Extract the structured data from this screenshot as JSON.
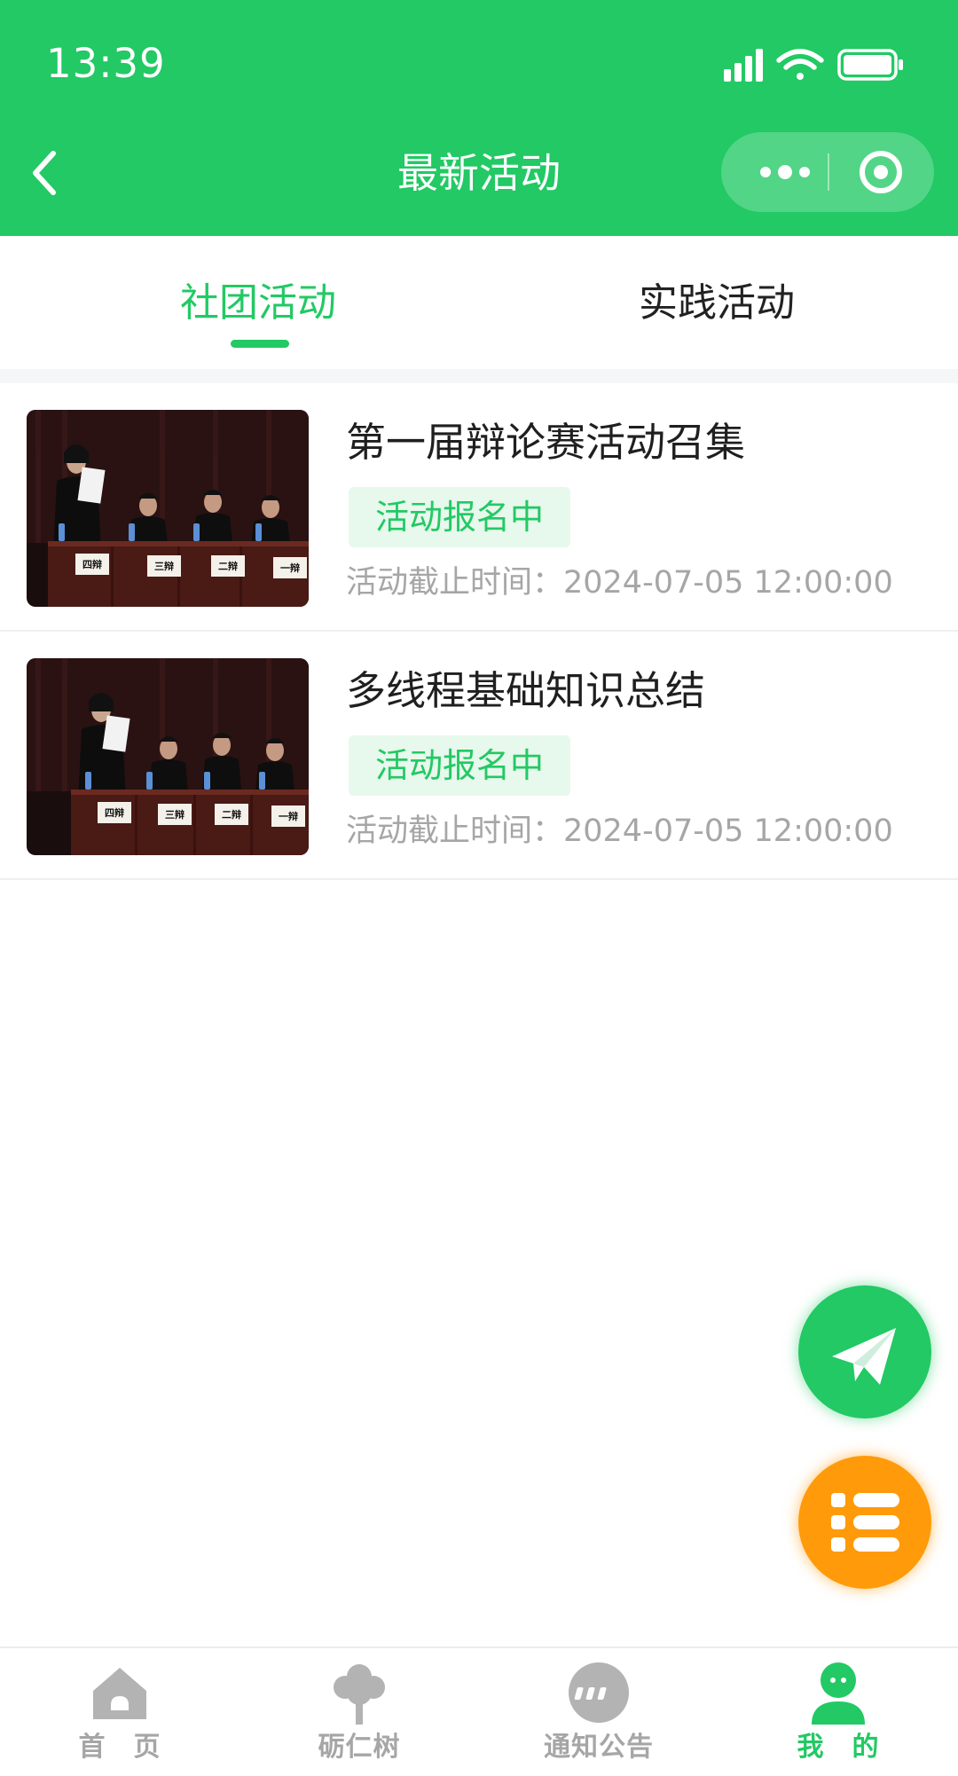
{
  "status_bar": {
    "time": "13:39"
  },
  "nav": {
    "title": "最新活动"
  },
  "tabs": [
    {
      "label": "社团活动",
      "active": true
    },
    {
      "label": "实践活动",
      "active": false
    }
  ],
  "activities": [
    {
      "title": "第一届辩论赛活动召集",
      "status": "活动报名中",
      "deadline": "活动截止时间：2024-07-05 12:00:00",
      "thumbnail": {
        "placards": [
          "四辩",
          "三辩",
          "二辩",
          "一辩"
        ]
      }
    },
    {
      "title": "多线程基础知识总结",
      "status": "活动报名中",
      "deadline": "活动截止时间：2024-07-05 12:00:00",
      "thumbnail": {
        "placards": [
          "四辩",
          "三辩",
          "二辩",
          "一辩"
        ]
      }
    }
  ],
  "fabs": {
    "send_icon": "paper-plane-icon",
    "list_icon": "list-icon"
  },
  "tabbar": [
    {
      "label": "首　页",
      "icon": "home-icon",
      "active": false
    },
    {
      "label": "砺仁树",
      "icon": "tree-icon",
      "active": false
    },
    {
      "label": "通知公告",
      "icon": "message-icon",
      "active": false
    },
    {
      "label": "我　的",
      "icon": "user-icon",
      "active": true
    }
  ],
  "colors": {
    "primary": "#22c964",
    "accent": "#ff9a0a",
    "inactive": "#a6a6a6"
  }
}
